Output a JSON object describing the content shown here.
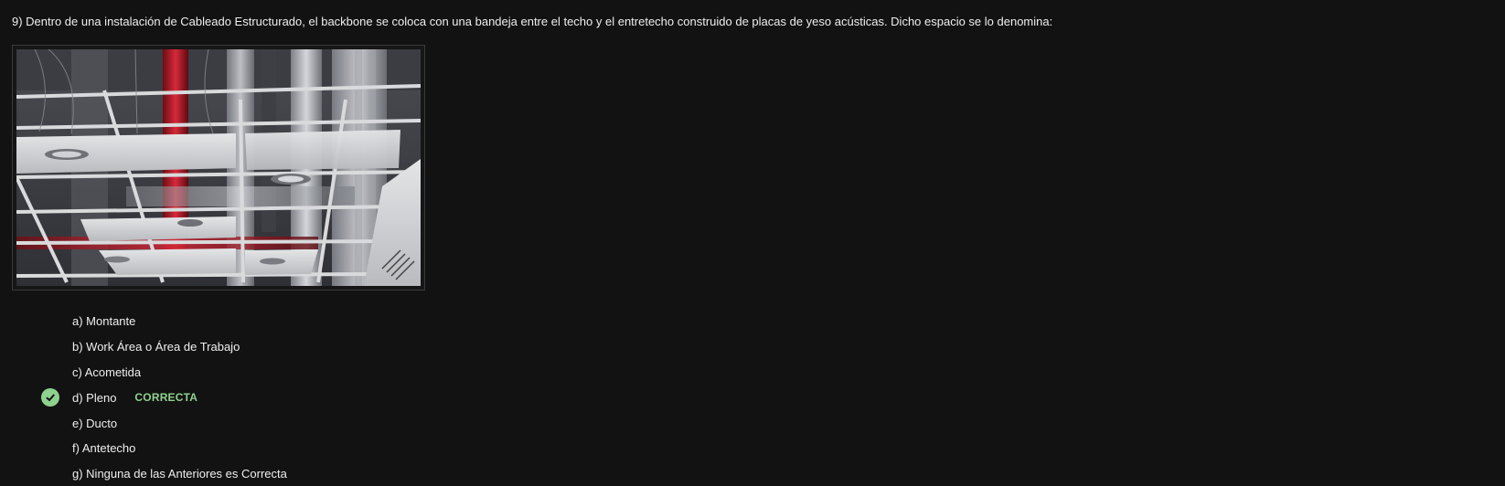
{
  "question": {
    "text": "9) Dentro de una instalación de Cableado Estructurado, el backbone se coloca con una bandeja entre el techo y el entretecho construido de placas de yeso acústicas. Dicho espacio se lo denomina:"
  },
  "figure": {
    "icon": "ceiling-plenum-photo"
  },
  "options": [
    {
      "text": "a) Montante",
      "correct": false
    },
    {
      "text": "b) Work Área o Área de Trabajo",
      "correct": false
    },
    {
      "text": "c) Acometida",
      "correct": false
    },
    {
      "text": "d) Pleno",
      "correct": true,
      "badge": "CORRECTA"
    },
    {
      "text": "e) Ducto",
      "correct": false
    },
    {
      "text": "f) Antetecho",
      "correct": false
    },
    {
      "text": "g) Ninguna de las Anteriores es Correcta",
      "correct": false
    }
  ],
  "colors": {
    "background": "#121212",
    "text": "#eeeeee",
    "correct": "#8fd18e"
  },
  "icons": {
    "correct_mark": "check-circle-icon"
  }
}
